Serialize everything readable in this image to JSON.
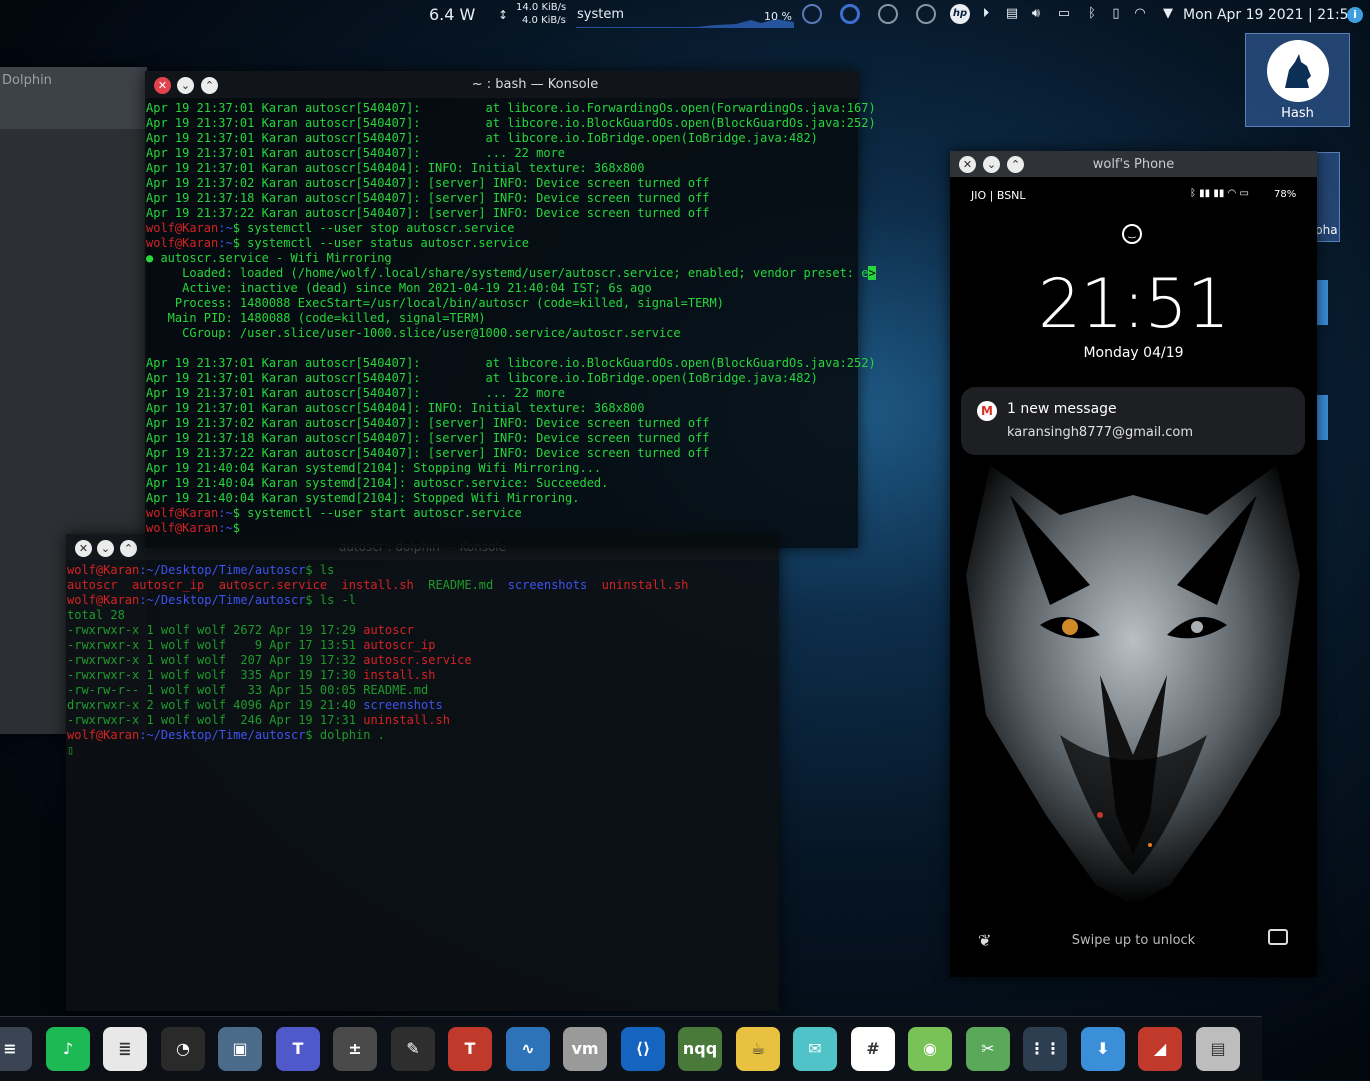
{
  "top_panel": {
    "power": "6.4 W",
    "net_up": "14.0 KiB/s",
    "net_down": "4.0 KiB/s",
    "cpu_label": "system",
    "cpu_percent": "10 %",
    "hp_label": "hp",
    "datetime": "Mon Apr 19 2021 | 21:51",
    "info_label": "i"
  },
  "desktop": {
    "hash_icon_label": "Hash",
    "partial_icon_label": "pha"
  },
  "dolphin": {
    "title": "Dolphin"
  },
  "konsole_main": {
    "title": "~ : bash — Konsole",
    "lines": [
      [
        {
          "t": "Apr 19 21:37:01 Karan autoscr[540407]:         at libcore.io.ForwardingOs.open(ForwardingOs.java:167)",
          "c": "g"
        }
      ],
      [
        {
          "t": "Apr 19 21:37:01 Karan autoscr[540407]:         at libcore.io.BlockGuardOs.open(BlockGuardOs.java:252)",
          "c": "g"
        }
      ],
      [
        {
          "t": "Apr 19 21:37:01 Karan autoscr[540407]:         at libcore.io.IoBridge.open(IoBridge.java:482)",
          "c": "g"
        }
      ],
      [
        {
          "t": "Apr 19 21:37:01 Karan autoscr[540407]:         ... 22 more",
          "c": "g"
        }
      ],
      [
        {
          "t": "Apr 19 21:37:01 Karan autoscr[540404]: INFO: Initial texture: 368x800",
          "c": "g"
        }
      ],
      [
        {
          "t": "Apr 19 21:37:02 Karan autoscr[540407]: [server] INFO: Device screen turned off",
          "c": "g"
        }
      ],
      [
        {
          "t": "Apr 19 21:37:18 Karan autoscr[540407]: [server] INFO: Device screen turned off",
          "c": "g"
        }
      ],
      [
        {
          "t": "Apr 19 21:37:22 Karan autoscr[540407]: [server] INFO: Device screen turned off",
          "c": "g"
        }
      ],
      [
        {
          "t": "wolf@Karan",
          "c": "r"
        },
        {
          "t": ":~",
          "c": "b"
        },
        {
          "t": "$ systemctl --user stop autoscr.service",
          "c": "g"
        }
      ],
      [
        {
          "t": "wolf@Karan",
          "c": "r"
        },
        {
          "t": ":~",
          "c": "b"
        },
        {
          "t": "$ systemctl --user status autoscr.service",
          "c": "g"
        }
      ],
      [
        {
          "t": "● autoscr.service - Wifi Mirroring",
          "c": "g"
        }
      ],
      [
        {
          "t": "     Loaded: loaded (/home/wolf/.local/share/systemd/user/autoscr.service; enabled; vendor preset: e",
          "c": "g"
        },
        {
          "t": ">",
          "c": "cursor"
        }
      ],
      [
        {
          "t": "     Active: inactive (dead) since Mon 2021-04-19 21:40:04 IST; 6s ago",
          "c": "g"
        }
      ],
      [
        {
          "t": "    Process: 1480088 ExecStart=/usr/local/bin/autoscr (code=killed, signal=TERM)",
          "c": "g"
        }
      ],
      [
        {
          "t": "   Main PID: 1480088 (code=killed, signal=TERM)",
          "c": "g"
        }
      ],
      [
        {
          "t": "     CGroup: /user.slice/user-1000.slice/user@1000.service/autoscr.service",
          "c": "g"
        }
      ],
      [
        {
          "t": " ",
          "c": "g"
        }
      ],
      [
        {
          "t": "Apr 19 21:37:01 Karan autoscr[540407]:         at libcore.io.BlockGuardOs.open(BlockGuardOs.java:252)",
          "c": "g"
        }
      ],
      [
        {
          "t": "Apr 19 21:37:01 Karan autoscr[540407]:         at libcore.io.IoBridge.open(IoBridge.java:482)",
          "c": "g"
        }
      ],
      [
        {
          "t": "Apr 19 21:37:01 Karan autoscr[540407]:         ... 22 more",
          "c": "g"
        }
      ],
      [
        {
          "t": "Apr 19 21:37:01 Karan autoscr[540404]: INFO: Initial texture: 368x800",
          "c": "g"
        }
      ],
      [
        {
          "t": "Apr 19 21:37:02 Karan autoscr[540407]: [server] INFO: Device screen turned off",
          "c": "g"
        }
      ],
      [
        {
          "t": "Apr 19 21:37:18 Karan autoscr[540407]: [server] INFO: Device screen turned off",
          "c": "g"
        }
      ],
      [
        {
          "t": "Apr 19 21:37:22 Karan autoscr[540407]: [server] INFO: Device screen turned off",
          "c": "g"
        }
      ],
      [
        {
          "t": "Apr 19 21:40:04 Karan systemd[2104]: Stopping Wifi Mirroring...",
          "c": "g"
        }
      ],
      [
        {
          "t": "Apr 19 21:40:04 Karan systemd[2104]: autoscr.service: Succeeded.",
          "c": "g"
        }
      ],
      [
        {
          "t": "Apr 19 21:40:04 Karan systemd[2104]: Stopped Wifi Mirroring.",
          "c": "g"
        }
      ],
      [
        {
          "t": "wolf@Karan",
          "c": "r"
        },
        {
          "t": ":~",
          "c": "b"
        },
        {
          "t": "$ systemctl --user start autoscr.service",
          "c": "g"
        }
      ],
      [
        {
          "t": "wolf@Karan",
          "c": "r"
        },
        {
          "t": ":~",
          "c": "b"
        },
        {
          "t": "$",
          "c": "g"
        }
      ]
    ]
  },
  "konsole_second": {
    "title": "autoscr : dolphin — Konsole",
    "lines": [
      [
        {
          "t": "wolf@Karan",
          "c": "r"
        },
        {
          "t": ":~/Desktop/Time/autoscr",
          "c": "b"
        },
        {
          "t": "$ ls",
          "c": "dg"
        }
      ],
      [
        {
          "t": "autoscr  autoscr_ip  autoscr.service  install.sh  ",
          "c": "r"
        },
        {
          "t": "README.md  ",
          "c": "dg"
        },
        {
          "t": "screenshots",
          "c": "b"
        },
        {
          "t": "  uninstall.sh",
          "c": "r"
        }
      ],
      [
        {
          "t": "wolf@Karan",
          "c": "r"
        },
        {
          "t": ":~/Desktop/Time/autoscr",
          "c": "b"
        },
        {
          "t": "$ ls -l",
          "c": "dg"
        }
      ],
      [
        {
          "t": "total 28",
          "c": "dg"
        }
      ],
      [
        {
          "t": "-rwxrwxr-x 1 wolf wolf 2672 Apr 19 17:29 ",
          "c": "dg"
        },
        {
          "t": "autoscr",
          "c": "r"
        }
      ],
      [
        {
          "t": "-rwxrwxr-x 1 wolf wolf    9 Apr 17 13:51 ",
          "c": "dg"
        },
        {
          "t": "autoscr_ip",
          "c": "r"
        }
      ],
      [
        {
          "t": "-rwxrwxr-x 1 wolf wolf  207 Apr 19 17:32 ",
          "c": "dg"
        },
        {
          "t": "autoscr.service",
          "c": "r"
        }
      ],
      [
        {
          "t": "-rwxrwxr-x 1 wolf wolf  335 Apr 19 17:30 ",
          "c": "dg"
        },
        {
          "t": "install.sh",
          "c": "r"
        }
      ],
      [
        {
          "t": "-rw-rw-r-- 1 wolf wolf   33 Apr 15 00:05 README.md",
          "c": "dg"
        }
      ],
      [
        {
          "t": "drwxrwxr-x 2 wolf wolf 4096 Apr 19 21:40 ",
          "c": "dg"
        },
        {
          "t": "screenshots",
          "c": "b"
        }
      ],
      [
        {
          "t": "-rwxrwxr-x 1 wolf wolf  246 Apr 19 17:31 ",
          "c": "dg"
        },
        {
          "t": "uninstall.sh",
          "c": "r"
        }
      ],
      [
        {
          "t": "wolf@Karan",
          "c": "r"
        },
        {
          "t": ":~/Desktop/Time/autoscr",
          "c": "b"
        },
        {
          "t": "$ dolphin .",
          "c": "dg"
        }
      ],
      [
        {
          "t": "▯",
          "c": "dg"
        }
      ]
    ]
  },
  "phone": {
    "title": "wolf's Phone",
    "carrier": "JIO | BSNL",
    "battery": "78%",
    "time": "21:51",
    "date": "Monday 04/19",
    "notification_title": "1 new message",
    "notification_body": "karansingh8777@gmail.com",
    "unlock_hint": "Swipe up to unlock"
  },
  "dock": {
    "apps": [
      {
        "name": "settings",
        "bg": "#3a4452",
        "glyph": "≡"
      },
      {
        "name": "spotify",
        "bg": "#1db954",
        "glyph": "♪"
      },
      {
        "name": "text-editor",
        "bg": "#e8e8e8",
        "glyph": "≣"
      },
      {
        "name": "timeshift",
        "bg": "#2a2a2a",
        "glyph": "◔"
      },
      {
        "name": "screenshot-tool",
        "bg": "#4b6b8a",
        "glyph": "▣"
      },
      {
        "name": "teams",
        "bg": "#5059c9",
        "glyph": "T"
      },
      {
        "name": "calculator",
        "bg": "#4a4a4a",
        "glyph": "±"
      },
      {
        "name": "notes",
        "bg": "#2e2e2e",
        "glyph": "✎"
      },
      {
        "name": "typora",
        "bg": "#c0392b",
        "glyph": "T"
      },
      {
        "name": "system-monitor",
        "bg": "#2e73b8",
        "glyph": "∿"
      },
      {
        "name": "virtualbox",
        "bg": "#9a9a9a",
        "glyph": "vm"
      },
      {
        "name": "vscode",
        "bg": "#1565c0",
        "glyph": "⟨⟩"
      },
      {
        "name": "nqq",
        "bg": "#4a7a3a",
        "glyph": "nqq"
      },
      {
        "name": "genie",
        "bg": "#e8c140",
        "glyph": "☕"
      },
      {
        "name": "mail",
        "bg": "#4fc3c7",
        "glyph": "✉"
      },
      {
        "name": "slack",
        "bg": "#ffffff",
        "glyph": "#"
      },
      {
        "name": "android-studio",
        "bg": "#78c257",
        "glyph": "◉"
      },
      {
        "name": "kdenlive",
        "bg": "#5aa85a",
        "glyph": "✂"
      },
      {
        "name": "app-grid",
        "bg": "#2c3e50",
        "glyph": "⋮⋮"
      },
      {
        "name": "downloads",
        "bg": "#3b8fd9",
        "glyph": "⬇"
      },
      {
        "name": "kite",
        "bg": "#c0392b",
        "glyph": "◢"
      },
      {
        "name": "archiver",
        "bg": "#bdbdbd",
        "glyph": "▤"
      }
    ]
  }
}
